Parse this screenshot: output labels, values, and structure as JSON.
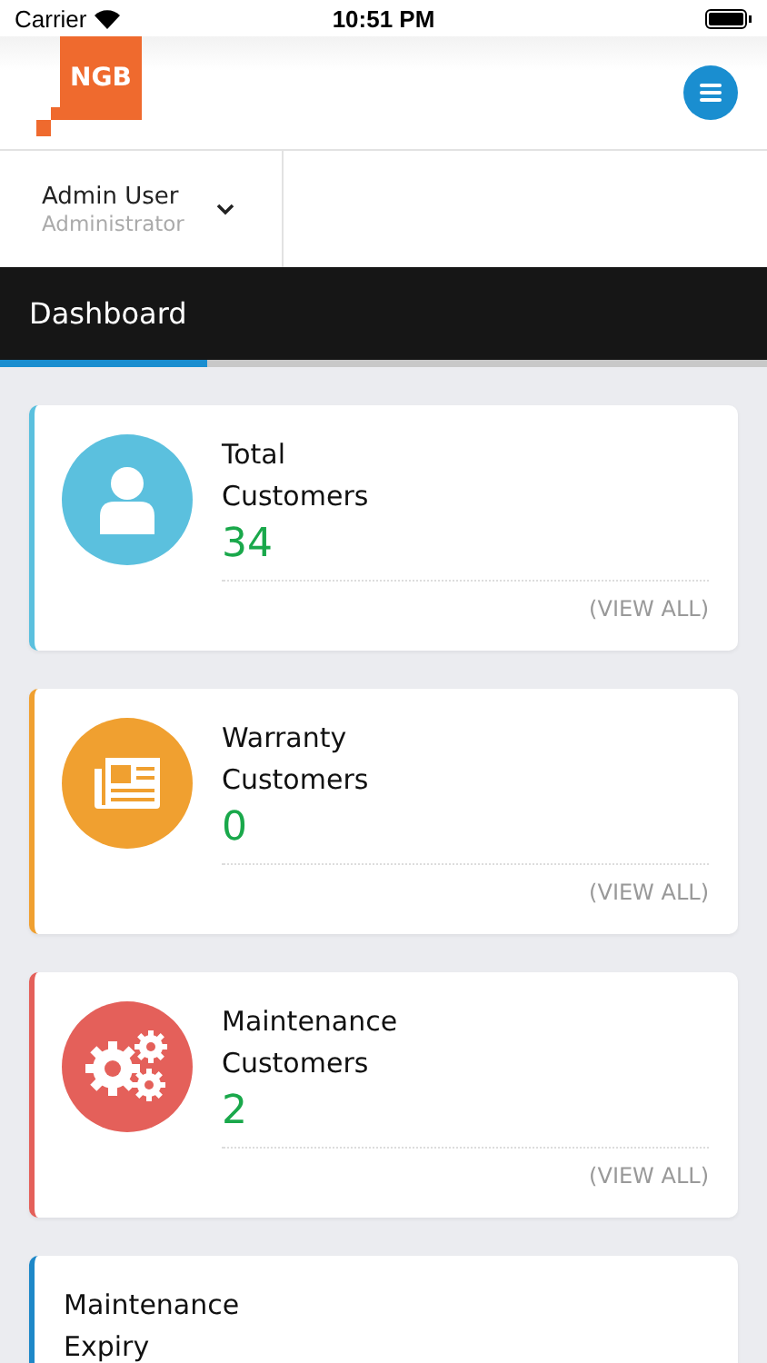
{
  "status_bar": {
    "carrier": "Carrier",
    "time": "10:51 PM"
  },
  "header": {
    "logo": "NGB"
  },
  "user": {
    "name": "Admin User",
    "role": "Administrator"
  },
  "title_bar": {
    "title": "Dashboard",
    "level": 0.27
  },
  "cards": [
    {
      "kind": "person",
      "color": "#5bc0de",
      "title": "Total Customers",
      "count": "34",
      "link": "(VIEW ALL)"
    },
    {
      "kind": "news",
      "color": "#f0a030",
      "title": "Warranty Customers",
      "count": "0",
      "link": "(VIEW ALL)"
    },
    {
      "kind": "gears",
      "color": "#e4605a",
      "title": "Maintenance Customers",
      "count": "2",
      "link": "(VIEW ALL)"
    },
    {
      "kind": "plain",
      "color": "#1e88c8",
      "title": "Maintenance Expiry"
    }
  ]
}
